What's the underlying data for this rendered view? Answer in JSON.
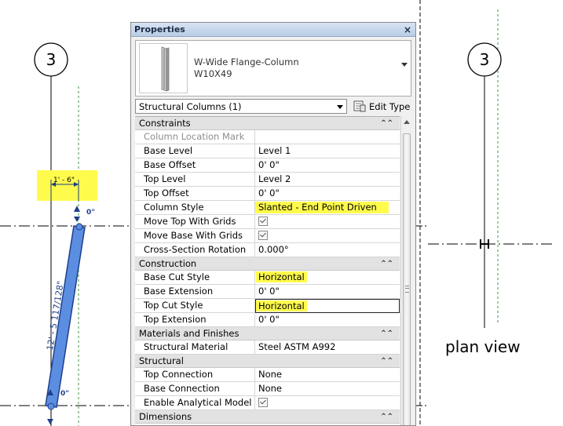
{
  "drawing": {
    "grid_marker_left": "3",
    "grid_marker_right": "3",
    "dimension_label": "1' - 6\"",
    "top_tag": "0\"",
    "bottom_tag": "0\"",
    "column_length_label": "12' - 5 117/128\"",
    "plan_view_label": "plan view",
    "highlight_color": "#fffb4d",
    "column_color": "#5b8ee0"
  },
  "panel": {
    "title": "Properties",
    "close_icon": "×",
    "type_selector": {
      "family": "W-Wide Flange-Column",
      "type": "W10X49"
    },
    "filter": {
      "selected": "Structural Columns (1)"
    },
    "edit_type_label": "Edit Type",
    "groups": [
      {
        "name": "Constraints",
        "rows": [
          {
            "name": "Column Location Mark",
            "value": ""
          },
          {
            "name": "Base Level",
            "value": "Level 1"
          },
          {
            "name": "Base Offset",
            "value": "0'  0\""
          },
          {
            "name": "Top Level",
            "value": "Level 2"
          },
          {
            "name": "Top Offset",
            "value": "0'  0\""
          },
          {
            "name": "Column Style",
            "value": "Slanted - End Point Driven"
          },
          {
            "name": "Move Top With Grids",
            "value": "checked"
          },
          {
            "name": "Move Base With Grids",
            "value": "checked"
          },
          {
            "name": "Cross-Section Rotation",
            "value": "0.000°"
          }
        ]
      },
      {
        "name": "Construction",
        "rows": [
          {
            "name": "Base Cut Style",
            "value": "Horizontal"
          },
          {
            "name": "Base Extension",
            "value": "0'  0\""
          },
          {
            "name": "Top Cut Style",
            "value": "Horizontal"
          },
          {
            "name": "Top Extension",
            "value": "0'  0\""
          }
        ]
      },
      {
        "name": "Materials and Finishes",
        "rows": [
          {
            "name": "Structural Material",
            "value": "Steel ASTM A992"
          }
        ]
      },
      {
        "name": "Structural",
        "rows": [
          {
            "name": "Top Connection",
            "value": "None"
          },
          {
            "name": "Base Connection",
            "value": "None"
          },
          {
            "name": "Enable Analytical Model",
            "value": "checked"
          }
        ]
      },
      {
        "name": "Dimensions",
        "rows": []
      }
    ]
  }
}
